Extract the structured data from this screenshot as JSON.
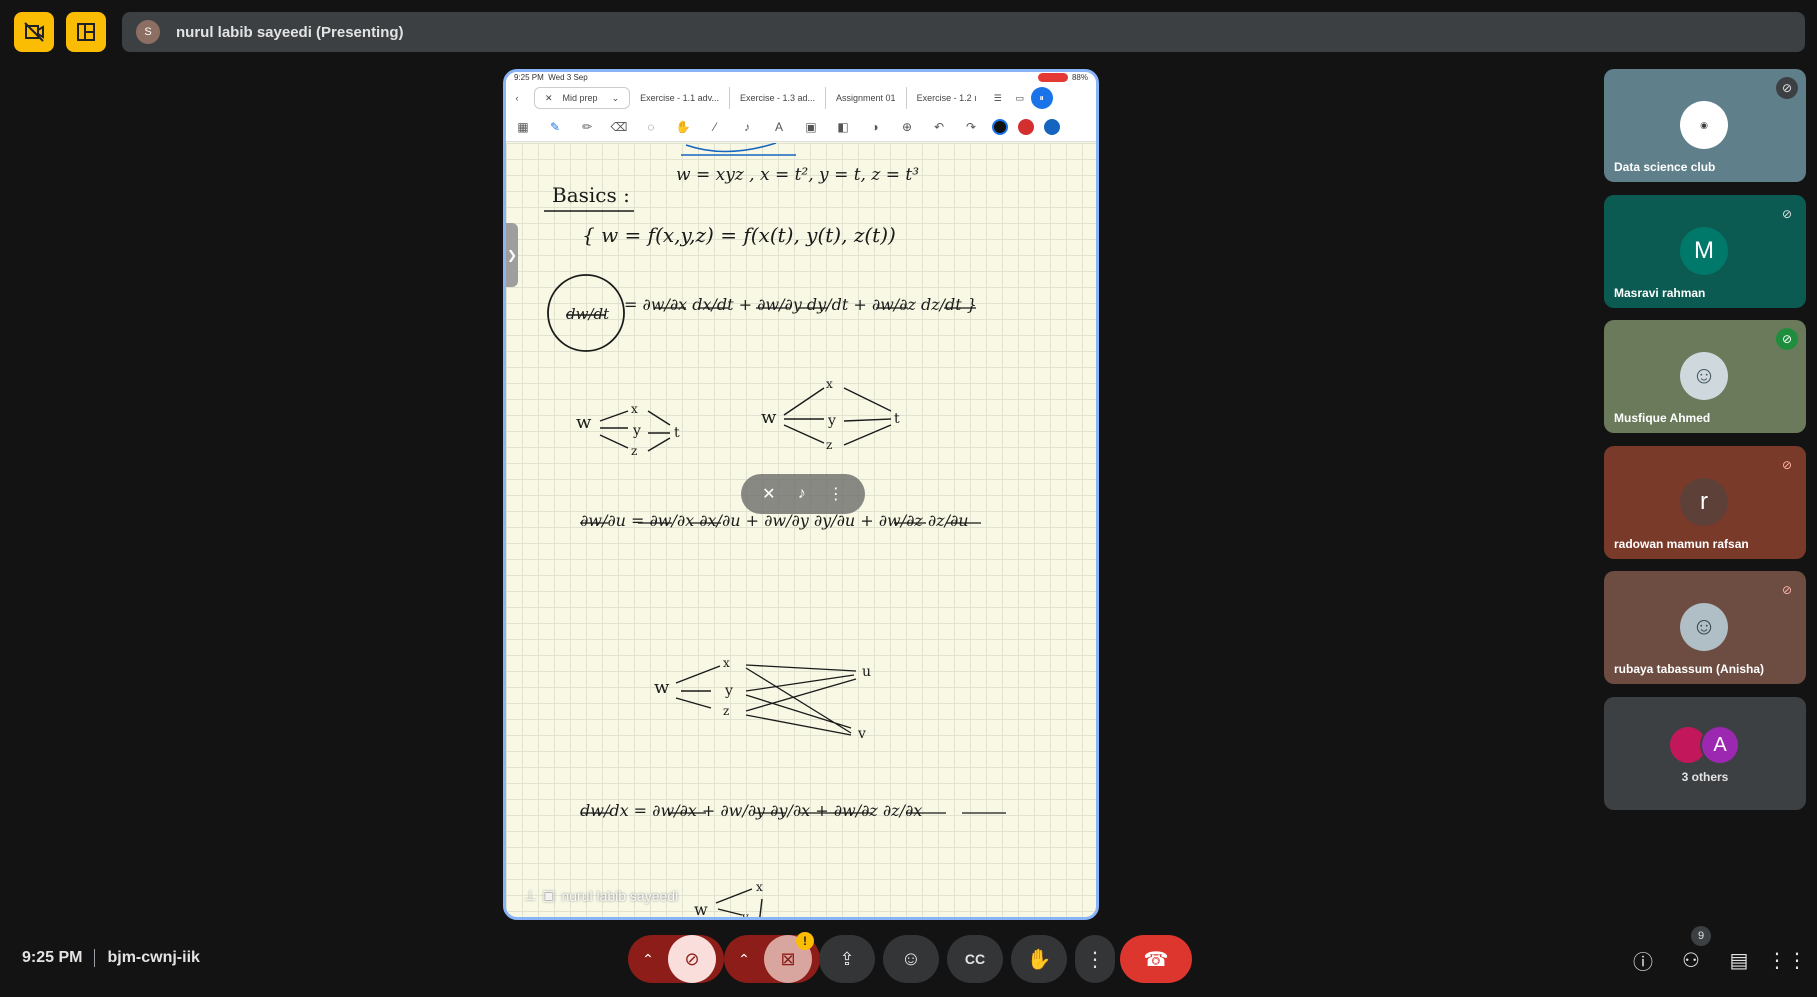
{
  "top": {
    "presenter_initial": "S",
    "presenter_label": "nurul labib sayeedi (Presenting)"
  },
  "shared_screen": {
    "status_time": "9:25 PM",
    "status_date": "Wed 3 Sep",
    "battery": "88%",
    "tabs": [
      "Mid prep",
      "Exercise - 1.1 adv...",
      "Exercise - 1.3 ad...",
      "Assignment 01",
      "Exercise - 1.2 ı"
    ],
    "notes": {
      "heading": "Basics :",
      "line1": "w = xyz ,  x = t², y = t, z = t³",
      "line2": "{ w = f(x,y,z) = f(x(t), y(t), z(t))",
      "line3_lhs": "dw/dt",
      "line3_rhs": "= ∂w/∂x dx/dt + ∂w/∂y dy/dt + ∂w/∂z dz/dt }",
      "line4": "∂w/∂u = ∂w/∂x ∂x/∂u + ∂w/∂y ∂y/∂u + ∂w/∂z ∂z/∂u",
      "line5": "dw/dx = ∂w/∂x + ∂w/∂y ∂y/∂x + ∂w/∂z ∂z/∂x"
    },
    "presenter_caption": "nurul labib sayeedi",
    "colors": {
      "border": "#8ab4f8",
      "paper": "#f8f8e4",
      "grid": "#dfe3cf",
      "ink": "#1a1a1a"
    }
  },
  "participants": [
    {
      "name": "Data science club",
      "avatar_text": "",
      "bg": "#5f7f8a",
      "muted": true,
      "mic_bg": "#3c4043"
    },
    {
      "name": "Masravi rahman",
      "avatar_text": "M",
      "bg": "#0b5b52",
      "muted": true,
      "mic_bg": "#0b5b52",
      "avatar_bg": "#00796b"
    },
    {
      "name": "Musfique Ahmed",
      "avatar_text": "",
      "bg": "#6a7a5b",
      "muted": false,
      "mic_bg": "#1e8e3e"
    },
    {
      "name": "radowan mamun rafsan",
      "avatar_text": "r",
      "bg": "#7a3a2a",
      "muted": true,
      "mic_bg": "#7a3a2a",
      "avatar_bg": "#5d4037"
    },
    {
      "name": "rubaya tabassum (Anisha)",
      "avatar_text": "",
      "bg": "#6d4c41",
      "muted": true,
      "mic_bg": "#6d4c41"
    }
  ],
  "others": {
    "label": "3 others",
    "avatar_letter": "A"
  },
  "bottom": {
    "time": "9:25 PM",
    "meeting_code": "bjm-cwnj-iik",
    "people_count": "9",
    "camera_warning": "!"
  }
}
